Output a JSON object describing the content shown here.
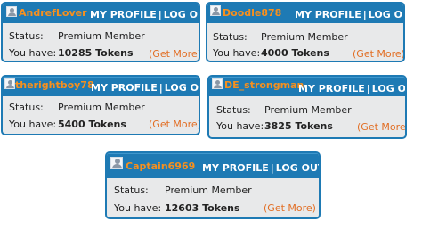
{
  "nav": {
    "my_profile": "MY PROFILE",
    "separator": "|",
    "log_out": "LOG OUT"
  },
  "labels": {
    "status": "Status:",
    "you_have": "You have:",
    "get_more": "(Get More)"
  },
  "colors": {
    "header": "#1e7ab4",
    "username": "#f7901e",
    "get_more": "#e26e24",
    "panel": "#e8e9ea"
  },
  "cards": [
    {
      "username": "AndrefLover",
      "status": "Premium Member",
      "tokens": "10285 Tokens"
    },
    {
      "username": "Doodle878",
      "status": "Premium Member",
      "tokens": "4000 Tokens"
    },
    {
      "username": "therightboy78",
      "status": "Premium Member",
      "tokens": "5400 Tokens"
    },
    {
      "username": "DE_strongman",
      "status": "Premium Member",
      "tokens": "3825 Tokens"
    },
    {
      "username": "Captain6969",
      "status": "Premium Member",
      "tokens": "12603 Tokens"
    }
  ]
}
